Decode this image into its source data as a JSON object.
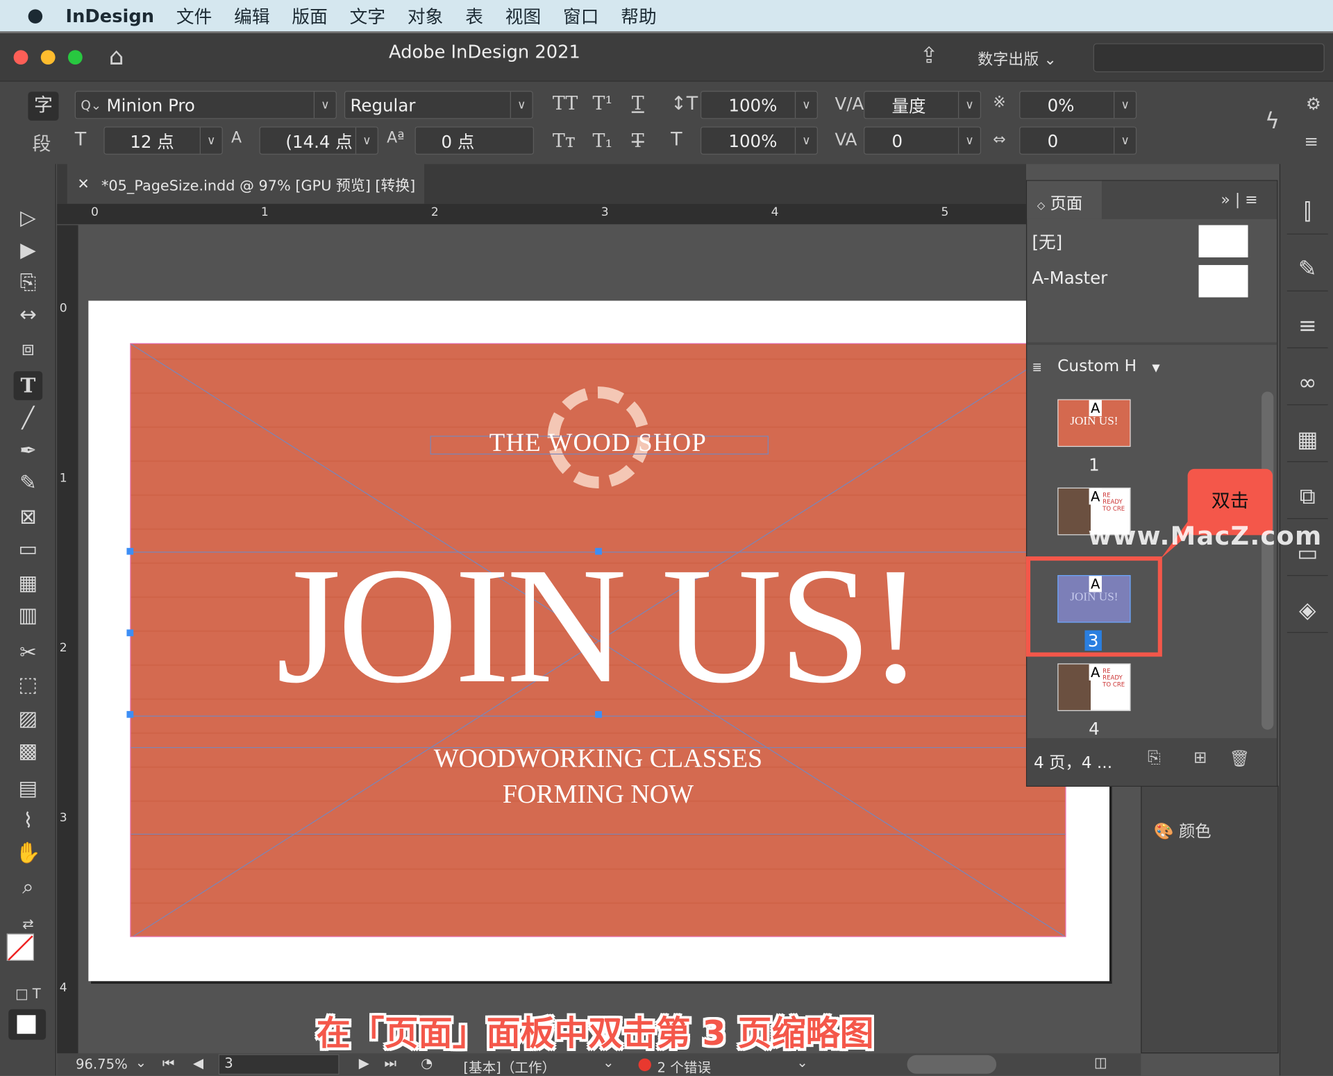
{
  "menubar": {
    "apple": "",
    "items": [
      "InDesign",
      "文件",
      "编辑",
      "版面",
      "文字",
      "对象",
      "表",
      "视图",
      "窗口",
      "帮助"
    ]
  },
  "titlebar": {
    "title": "Adobe InDesign 2021",
    "workspace": "数字出版",
    "search_value": ""
  },
  "control": {
    "char_tab": "字",
    "para_tab": "段",
    "font_family": "Minion Pro",
    "font_style": "Regular",
    "font_size": "12 点",
    "leading": "(14.4 点",
    "baseline_shift": "0 点",
    "vertical_scale": "100%",
    "horizontal_scale": "100%",
    "kerning": "量度",
    "tracking": "0",
    "tsume": "0%",
    "char_rotation": "0"
  },
  "document_tab": {
    "title": "*05_PageSize.indd @ 97% [GPU 预览] [转换]"
  },
  "ruler": {
    "h_ticks": [
      "0",
      "1",
      "2",
      "3",
      "4",
      "5"
    ],
    "v_ticks": [
      "0",
      "1",
      "2",
      "3",
      "4"
    ]
  },
  "artwork": {
    "shop_name": "THE WOOD SHOP",
    "headline": "JOIN US!",
    "sub1": "WOODWORKING CLASSES",
    "sub2": "FORMING NOW",
    "bg_color": "#d4694f"
  },
  "pages_panel": {
    "title": "页面",
    "masters": [
      "[无]",
      "A-Master"
    ],
    "size_label": "Custom H",
    "pages": [
      {
        "num": "1",
        "master": "A",
        "thumb": "JOIN US!"
      },
      {
        "num": "",
        "master": "A",
        "thumb": "RE READY TO CRE"
      },
      {
        "num": "3",
        "master": "A",
        "thumb": "JOIN US!",
        "selected": true
      },
      {
        "num": "4",
        "master": "A",
        "thumb": "RE READY TO CRE"
      }
    ],
    "footer": "4 页，4 ..."
  },
  "color_panel": {
    "label": "颜色"
  },
  "annotation": {
    "callout": "双击",
    "caption": "在「页面」面板中双击第 3 页缩略图",
    "watermark": "www.MacZ.com",
    "accent": "#f4574a"
  },
  "status": {
    "zoom": "96.75%",
    "page": "3",
    "preflight_profile": "[基本]（工作）",
    "errors": "2 个错误",
    "error_color": "#e8392f"
  }
}
